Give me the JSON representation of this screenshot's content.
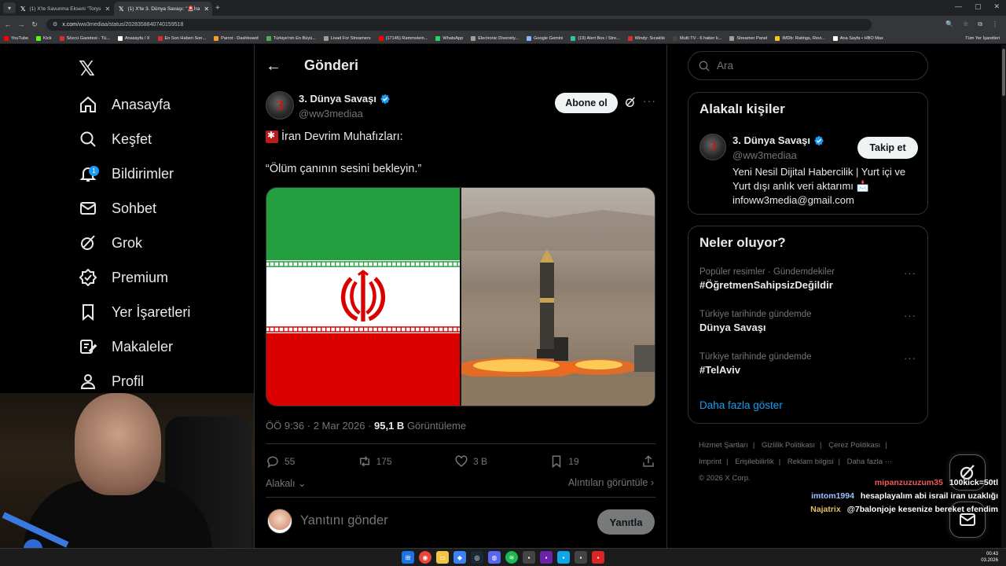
{
  "browser": {
    "tabs": [
      {
        "label": "(1) X'te Savunma Ekseni \"Torys"
      },
      {
        "label": "(1) X'te 3. Dünya Savaşı: \"🚨İra"
      }
    ],
    "url_host": "x.com",
    "url_path": "/ww3mediaa/status/2028358840740159518",
    "bookmarks": [
      {
        "label": "YouTube",
        "color": "#ff0000"
      },
      {
        "label": "Kick",
        "color": "#53fc18"
      },
      {
        "label": "Sözcü Gazetesi - Tü...",
        "color": "#d32f2f"
      },
      {
        "label": "Anasayfa / X",
        "color": "#ffffff"
      },
      {
        "label": "En Son Haberi Son...",
        "color": "#d32f2f"
      },
      {
        "label": "Parrot - Dashboard",
        "color": "#f0a030"
      },
      {
        "label": "Türkiye'nin En Büyü...",
        "color": "#4caf50"
      },
      {
        "label": "Livad For Streamers",
        "color": "#9e9e9e"
      },
      {
        "label": "(17145) Rammstein...",
        "color": "#ff0000"
      },
      {
        "label": "WhatsApp",
        "color": "#25d366"
      },
      {
        "label": "Electronic Diversity...",
        "color": "#9e9e9e"
      },
      {
        "label": "Google Gemini",
        "color": "#8ab4f8"
      },
      {
        "label": "(19) Alert Box / Stre...",
        "color": "#31c3a2"
      },
      {
        "label": "Windy: Sıcaklık",
        "color": "#d32f2f"
      },
      {
        "label": "Multi TV - 6 haber k...",
        "color": "#424242"
      },
      {
        "label": "Streamer Panel",
        "color": "#9e9e9e"
      },
      {
        "label": "IMDb: Ratings, Revi...",
        "color": "#f5c518"
      },
      {
        "label": "Ana Sayfa • HBO Max",
        "color": "#ffffff"
      }
    ],
    "bookmarks_right": "Tüm Yer İşaretleri"
  },
  "nav": {
    "items": [
      {
        "label": "Anasayfa",
        "icon": "home-icon"
      },
      {
        "label": "Keşfet",
        "icon": "search-icon"
      },
      {
        "label": "Bildirimler",
        "icon": "bell-icon",
        "badge": "1"
      },
      {
        "label": "Sohbet",
        "icon": "mail-icon"
      },
      {
        "label": "Grok",
        "icon": "grok-icon"
      },
      {
        "label": "Premium",
        "icon": "premium-icon"
      },
      {
        "label": "Yer İşaretleri",
        "icon": "bookmark-icon"
      },
      {
        "label": "Makaleler",
        "icon": "article-icon"
      },
      {
        "label": "Profil",
        "icon": "profile-icon"
      }
    ]
  },
  "post": {
    "header_title": "Gönderi",
    "author_name": "3. Dünya Savaşı",
    "author_handle": "@ww3mediaa",
    "avatar_text": "3",
    "follow_label": "Abone ol",
    "line1": "İran Devrim Muhafızları:",
    "line2": "“Ölüm çanının sesini bekleyin.”",
    "time": "ÖÖ 9:36 · 2 Mar 2026 · ",
    "views": "95,1 B",
    "views_label": " Görüntüleme",
    "replies": "55",
    "reposts": "175",
    "likes": "3 B",
    "bookmarks": "19",
    "related_label": "Alakalı",
    "quotes_label": "Alıntıları görüntüle",
    "reply_placeholder": "Yanıtını gönder",
    "reply_button": "Yanıtla"
  },
  "sidebar": {
    "search_placeholder": "Ara",
    "related_title": "Alakalı kişiler",
    "related_name": "3. Dünya Savaşı",
    "related_handle": "@ww3mediaa",
    "related_follow": "Takip et",
    "related_bio": "Yeni Nesil Dijital Habercilik | Yurt içi ve Yurt dışı anlık veri aktarımı 📩 infoww3media@gmail.com",
    "trends_title": "Neler oluyor?",
    "trends": [
      {
        "context": "Popüler resimler · Gündemdekiler",
        "topic": "#ÖğretmenSahipsizDeğildir"
      },
      {
        "context": "Türkiye tarihinde gündemde",
        "topic": "Dünya Savaşı"
      },
      {
        "context": "Türkiye tarihinde gündemde",
        "topic": "#TelAviv"
      }
    ],
    "show_more": "Daha fazla göster",
    "footer_links": [
      "Hizmet Şartları",
      "Gizlilik Politikası",
      "Çerez Politikası",
      "Imprint",
      "Erişilebilirlik",
      "Reklam bilgisi",
      "Daha fazla ···"
    ],
    "copyright": "© 2026 X Corp."
  },
  "chat": [
    {
      "user": "mipanzuzuzum35",
      "msg": "100kick=50tl",
      "color": "red"
    },
    {
      "user": "imtom1994",
      "msg": "hesaplayalım abi israil iran uzaklığı",
      "color": "blue"
    },
    {
      "user": "Najatrix",
      "msg": "@7balonjoje kesenize bereket efendim",
      "color": "gold"
    }
  ],
  "taskbar": {
    "time": "00:43",
    "date": "03.2026"
  },
  "colors": {
    "accent": "#1d9bf0",
    "background": "#000000",
    "border": "#2f3336"
  }
}
